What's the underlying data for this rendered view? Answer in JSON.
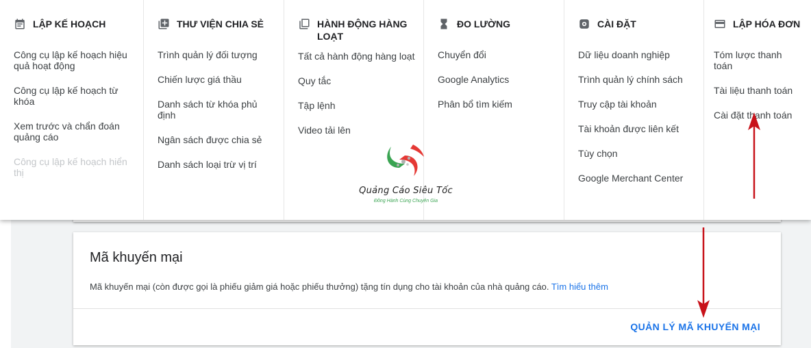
{
  "menu": {
    "columns": [
      {
        "title": "LẬP KẾ HOẠCH",
        "icon": "calendar-icon",
        "items": [
          "Công cụ lập kế hoạch hiệu quả hoạt động",
          "Công cụ lập kế hoạch từ khóa",
          "Xem trước và chẩn đoán quảng cáo",
          "Công cụ lập kế hoạch hiển thị"
        ]
      },
      {
        "title": "THƯ VIỆN CHIA SẺ",
        "icon": "library-icon",
        "items": [
          "Trình quản lý đối tượng",
          "Chiến lược giá thầu",
          "Danh sách từ khóa phủ định",
          "Ngân sách được chia sẻ",
          "Danh sách loại trừ vị trí"
        ]
      },
      {
        "title": "HÀNH ĐỘNG HÀNG LOẠT",
        "icon": "copy-icon",
        "items": [
          "Tất cả hành động hàng loạt",
          "Quy tắc",
          "Tập lệnh",
          "Video tải lên"
        ]
      },
      {
        "title": "ĐO LƯỜNG",
        "icon": "hourglass-icon",
        "items": [
          "Chuyển đổi",
          "Google Analytics",
          "Phân bổ tìm kiếm"
        ]
      },
      {
        "title": "CÀI ĐẶT",
        "icon": "settings-icon",
        "items": [
          "Dữ liệu doanh nghiệp",
          "Trình quản lý chính sách",
          "Truy cập tài khoản",
          "Tài khoản được liên kết",
          "Tùy chọn",
          "Google Merchant Center"
        ]
      },
      {
        "title": "LẬP HÓA ĐƠN",
        "icon": "credit-card-icon",
        "items": [
          "Tóm lược thanh toán",
          "Tài liệu thanh toán",
          "Cài đặt thanh toán"
        ]
      }
    ]
  },
  "watermark": {
    "name": "Quảng Cáo Siêu Tốc",
    "tagline": "Đồng Hành Cùng Chuyên Gia"
  },
  "promo": {
    "title": "Mã khuyến mại",
    "description": "Mã khuyến mại (còn được gọi là phiếu giảm giá hoặc phiếu thưởng) tặng tín dụng cho tài khoản của nhà quảng cáo.",
    "link": "Tìm hiểu thêm",
    "action": "QUẢN LÝ MÃ KHUYẾN MẠI"
  },
  "colors": {
    "accent": "#1a73e8",
    "annotation_arrow": "#c8121a"
  }
}
